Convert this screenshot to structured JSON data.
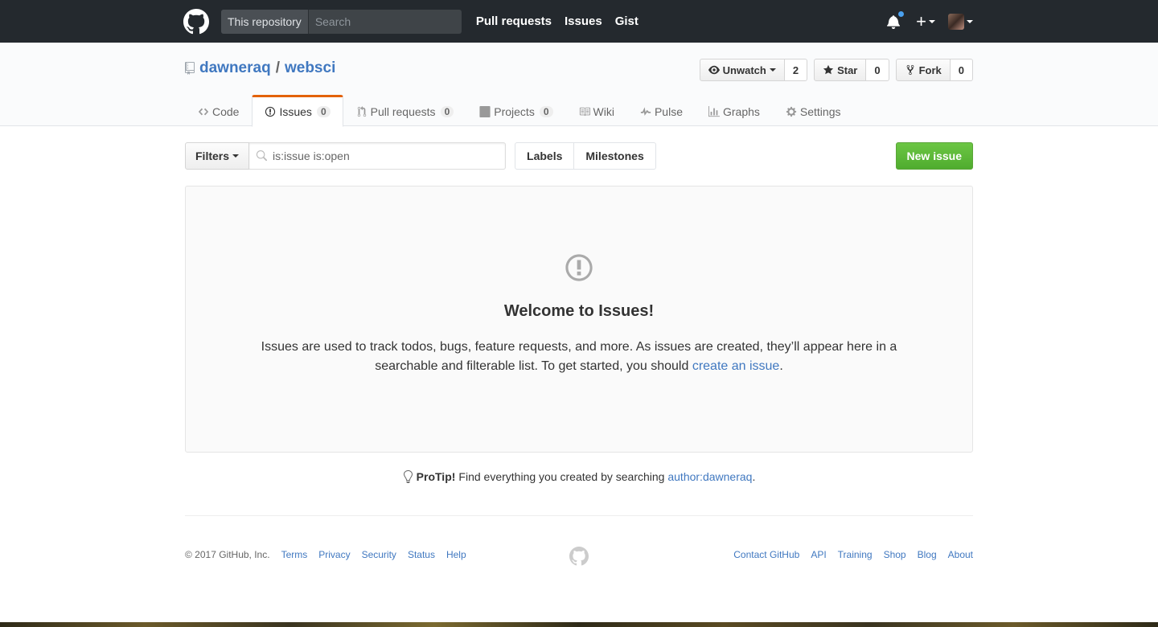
{
  "header": {
    "scope_label": "This repository",
    "search_placeholder": "Search",
    "nav": [
      "Pull requests",
      "Issues",
      "Gist"
    ],
    "plus_label": "+",
    "notification_indicator_color": "#4aa1f0"
  },
  "repo": {
    "owner": "dawneraq",
    "separator": "/",
    "name": "websci",
    "actions": {
      "watch_label": "Unwatch",
      "watch_count": "2",
      "star_label": "Star",
      "star_count": "0",
      "fork_label": "Fork",
      "fork_count": "0"
    },
    "tabs": [
      {
        "label": "Code",
        "icon": "code-icon"
      },
      {
        "label": "Issues",
        "icon": "issue-opened-icon",
        "count": "0",
        "selected": true
      },
      {
        "label": "Pull requests",
        "icon": "git-pull-request-icon",
        "count": "0"
      },
      {
        "label": "Projects",
        "icon": "project-icon",
        "count": "0"
      },
      {
        "label": "Wiki",
        "icon": "book-icon"
      },
      {
        "label": "Pulse",
        "icon": "pulse-icon"
      },
      {
        "label": "Graphs",
        "icon": "graph-icon"
      },
      {
        "label": "Settings",
        "icon": "gear-icon"
      }
    ]
  },
  "subnav": {
    "filters_label": "Filters",
    "search_value": "is:issue is:open",
    "labels_label": "Labels",
    "milestones_label": "Milestones",
    "new_issue_label": "New issue"
  },
  "blankslate": {
    "title": "Welcome to Issues!",
    "text_before": "Issues are used to track todos, bugs, feature requests, and more. As issues are created, they’ll appear here in a searchable and filterable list. To get started, you should ",
    "link_text": "create an issue",
    "text_after": "."
  },
  "protip": {
    "label": "ProTip!",
    "text": "Find everything you created by searching",
    "link": "author:dawneraq",
    "end": "."
  },
  "footer": {
    "copyright": "© 2017 GitHub, Inc.",
    "left_links": [
      "Terms",
      "Privacy",
      "Security",
      "Status",
      "Help"
    ],
    "right_links": [
      "Contact GitHub",
      "API",
      "Training",
      "Shop",
      "Blog",
      "About"
    ]
  },
  "colors": {
    "header_bg": "#24292e",
    "link": "#4078c0",
    "selected_tab_accent": "#e36209",
    "new_issue_green": "#6cc644"
  }
}
